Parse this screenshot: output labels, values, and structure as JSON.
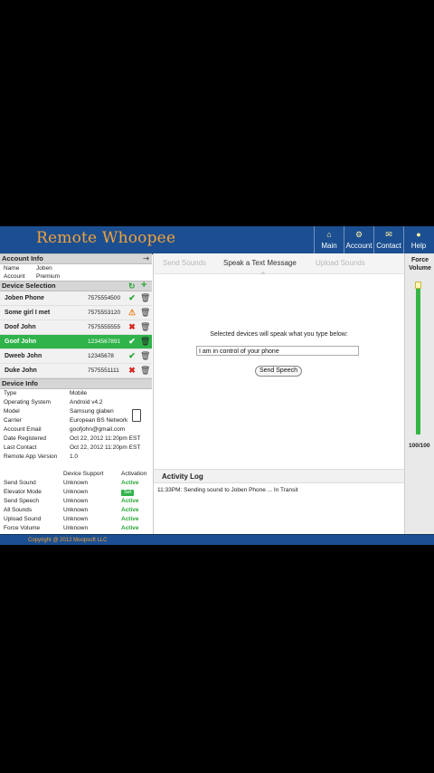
{
  "header": {
    "logo": "Remote Whoopee",
    "nav": [
      {
        "label": "Main",
        "icon": "house-icon"
      },
      {
        "label": "Account",
        "icon": "gear-icon"
      },
      {
        "label": "Contact",
        "icon": "envelope-icon"
      },
      {
        "label": "Help",
        "icon": "lightbulb-icon"
      }
    ]
  },
  "account_info": {
    "title": "Account Info",
    "rows": [
      {
        "key": "Name",
        "value": "Joben"
      },
      {
        "key": "Account",
        "value": "Premium"
      }
    ]
  },
  "device_selection": {
    "title": "Device Selection",
    "devices": [
      {
        "name": "Joben Phone",
        "phone": "7575554500",
        "status": "ok",
        "selected": false
      },
      {
        "name": "Some girl I met",
        "phone": "7575553120",
        "status": "warn",
        "selected": false
      },
      {
        "name": "Doof John",
        "phone": "7575555555",
        "status": "no",
        "selected": false
      },
      {
        "name": "Goof John",
        "phone": "1234567891",
        "status": "ok",
        "selected": true
      },
      {
        "name": "Dweeb John",
        "phone": "12345678",
        "status": "ok",
        "selected": false
      },
      {
        "name": "Duke John",
        "phone": "7575551111",
        "status": "no",
        "selected": false
      }
    ]
  },
  "device_info": {
    "title": "Device Info",
    "rows": [
      {
        "key": "Type",
        "value": "Mobile"
      },
      {
        "key": "Operating System",
        "value": "Android v4.2"
      },
      {
        "key": "Model",
        "value": "Samsung glaben"
      },
      {
        "key": "Carrier",
        "value": "European BS Network"
      },
      {
        "key": "Account Email",
        "value": "goofjohn@gmail.com"
      },
      {
        "key": "Date Registered",
        "value": "Oct 22, 2012 11:20pm EST"
      },
      {
        "key": "Last Contact",
        "value": "Oct 22, 2012 11:20pm EST"
      },
      {
        "key": "Remote App Version",
        "value": "1.0"
      }
    ]
  },
  "features": {
    "headers": {
      "support": "Device Support",
      "activation": "Activation"
    },
    "rows": [
      {
        "name": "Send Sound",
        "support": "Unknown",
        "activation": "Active",
        "kind": "text"
      },
      {
        "name": "Elevator Mode",
        "support": "Unknown",
        "activation": "Set",
        "kind": "button"
      },
      {
        "name": "Send Speech",
        "support": "Unknown",
        "activation": "Active",
        "kind": "text"
      },
      {
        "name": "All Sounds",
        "support": "Unknown",
        "activation": "Active",
        "kind": "text"
      },
      {
        "name": "Upload Sound",
        "support": "Unknown",
        "activation": "Active",
        "kind": "text"
      },
      {
        "name": "Force Volume",
        "support": "Unknown",
        "activation": "Active",
        "kind": "text"
      }
    ]
  },
  "tabs": [
    {
      "label": "Send Sounds",
      "active": false
    },
    {
      "label": "Speak a Text Message",
      "active": true
    },
    {
      "label": "Upload Sounds",
      "active": false
    }
  ],
  "speech": {
    "prompt": "Selected devices will speak what you type below:",
    "value": "I am in control of your phone",
    "button": "Send Speech"
  },
  "activity": {
    "title": "Activity Log",
    "lines": [
      "11:33PM: Sending sound to Joben Phone ... In Transit"
    ]
  },
  "volume": {
    "title": "Force Volume",
    "value_label": "100/100",
    "level": 1.0
  },
  "footer": {
    "copyright": "Copyright @ 2012 Moopsoft LLC"
  },
  "colors": {
    "brand_blue": "#1b4f91",
    "logo_orange": "#f3a13a",
    "status_green": "#2fb34a",
    "status_red": "#d7261e",
    "status_orange": "#ee7d14"
  }
}
